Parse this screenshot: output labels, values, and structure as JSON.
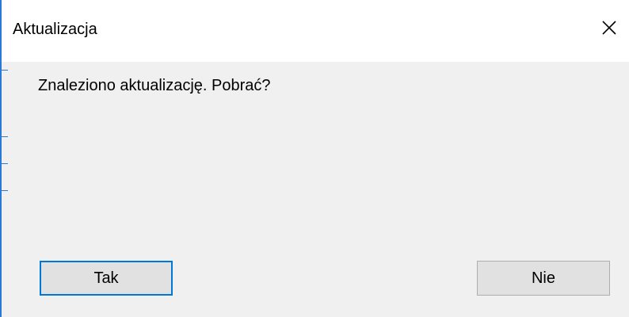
{
  "window": {
    "title": "Aktualizacja",
    "close_icon": "close-icon"
  },
  "message": "Znaleziono aktualizację. Pobrać?",
  "buttons": {
    "yes_label": "Tak",
    "no_label": "Nie"
  },
  "colors": {
    "accent": "#0078d7",
    "window_border": "#2b79d4",
    "body_background": "#f0f0f0",
    "button_background": "#e1e1e1"
  }
}
